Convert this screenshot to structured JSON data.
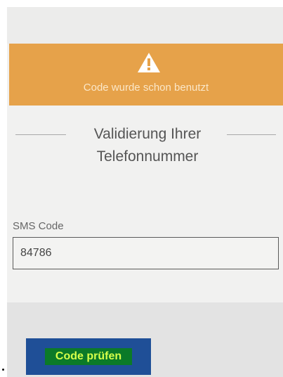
{
  "alert": {
    "icon": "warning-icon",
    "message": "Code wurde schon benutzt"
  },
  "heading": {
    "line1": "Validierung Ihrer",
    "line2": "Telefonnummer"
  },
  "sms_code": {
    "label": "SMS Code",
    "value": "84786"
  },
  "actions": {
    "verify_label": "Code prüfen"
  },
  "colors": {
    "alert_bg": "#e6a24a",
    "button_bg": "#1f4f97",
    "button_label_highlight": "#0b7a28",
    "button_label_text": "#d6ff4a"
  }
}
